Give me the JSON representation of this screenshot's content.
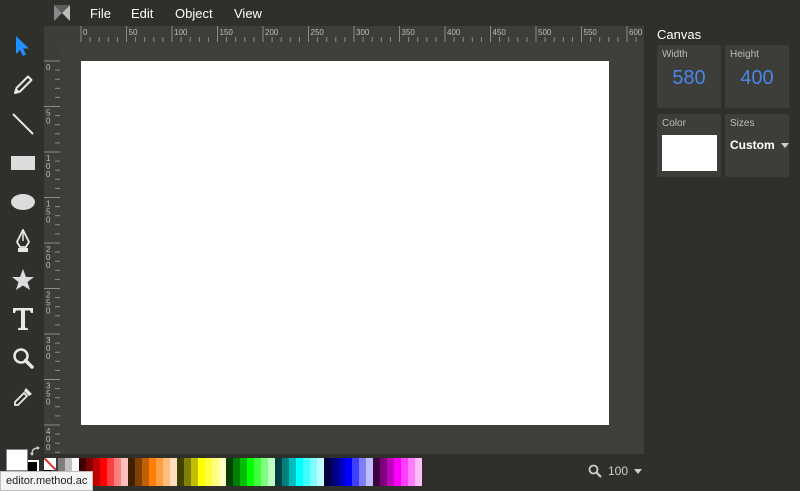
{
  "menu": {
    "items": [
      {
        "label": "File"
      },
      {
        "label": "Edit"
      },
      {
        "label": "Object"
      },
      {
        "label": "View"
      }
    ]
  },
  "tools": [
    {
      "name": "select-tool",
      "icon": "arrow-pointer-icon",
      "active": true
    },
    {
      "name": "pencil-tool",
      "icon": "pencil-icon"
    },
    {
      "name": "line-tool",
      "icon": "line-icon"
    },
    {
      "name": "rectangle-tool",
      "icon": "rectangle-icon"
    },
    {
      "name": "ellipse-tool",
      "icon": "ellipse-icon"
    },
    {
      "name": "pen-tool",
      "icon": "pen-nib-icon"
    },
    {
      "name": "star-tool",
      "icon": "star-icon"
    },
    {
      "name": "text-tool",
      "icon": "text-t-icon"
    },
    {
      "name": "zoom-tool",
      "icon": "magnifier-icon"
    },
    {
      "name": "eyedropper-tool",
      "icon": "eyedropper-icon"
    }
  ],
  "colors": {
    "accent": "#4a86e8",
    "fill": "#ffffff",
    "stroke": "#000000"
  },
  "ruler": {
    "horizontal_labels": [
      "0",
      "50",
      "100",
      "150",
      "200",
      "250",
      "300",
      "350",
      "400",
      "450",
      "500",
      "550",
      "600"
    ],
    "vertical_labels": [
      "0",
      "50",
      "100",
      "150",
      "200",
      "250",
      "300",
      "350",
      "400"
    ]
  },
  "panel": {
    "title": "Canvas",
    "width_label": "Width",
    "width_value": "580",
    "height_label": "Height",
    "height_value": "400",
    "color_label": "Color",
    "sizes_label": "Sizes",
    "sizes_value": "Custom"
  },
  "zoom": {
    "value": "100"
  },
  "tooltip": {
    "text": "editor.method.ac"
  },
  "palette": [
    "#000000",
    "#3f3f3f",
    "#7f7f7f",
    "#bfbfbf",
    "#ffffff",
    "#3f0000",
    "#7f0000",
    "#bf0000",
    "#ff0000",
    "#ff3f3f",
    "#ff7f7f",
    "#ffbfbf",
    "#3f1f00",
    "#7f3f00",
    "#bf5f00",
    "#ff7f00",
    "#ff9f3f",
    "#ffbf7f",
    "#ffdfbf",
    "#3f3f00",
    "#7f7f00",
    "#bfbf00",
    "#ffff00",
    "#ffff3f",
    "#ffff7f",
    "#ffffbf",
    "#003f00",
    "#007f00",
    "#00bf00",
    "#00ff00",
    "#3fff3f",
    "#7fff7f",
    "#bfffbf",
    "#003f3f",
    "#007f7f",
    "#00bfbf",
    "#00ffff",
    "#3fffff",
    "#7fffff",
    "#bfffff",
    "#00003f",
    "#00007f",
    "#0000bf",
    "#0000ff",
    "#3f3fff",
    "#7f7fff",
    "#bfbfff",
    "#3f003f",
    "#7f007f",
    "#bf00bf",
    "#ff00ff",
    "#ff3fff",
    "#ff7fff",
    "#ffbfff"
  ]
}
